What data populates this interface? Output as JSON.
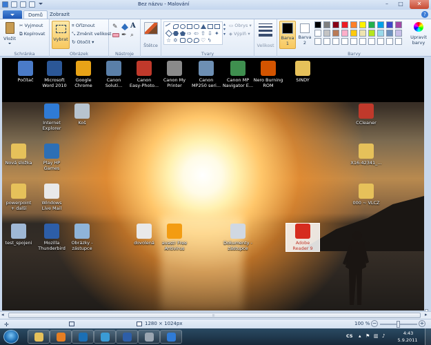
{
  "window": {
    "title": "Bez názvu - Malování"
  },
  "tabs": [
    {
      "label": "Domů",
      "active": true
    },
    {
      "label": "Zobrazit",
      "active": false
    }
  ],
  "ribbon": {
    "clipboard": {
      "paste": "Vložit",
      "cut": "Vyjmout",
      "copy": "Kopírovat",
      "label": "Schránka"
    },
    "image": {
      "select": "Vybrat",
      "crop": "Oříznout",
      "resize": "Změnit velikost",
      "rotate": "Otočit",
      "label": "Obrázek"
    },
    "tools": {
      "label": "Nástroje"
    },
    "brushes": {
      "label": "Štětce"
    },
    "shapes": {
      "outline": "Obrys",
      "fill": "Výplň",
      "label": "Tvary"
    },
    "size": {
      "label": "Velikost"
    },
    "colors": {
      "color1": "Barva\n1",
      "color2": "Barva\n2",
      "edit": "Upravit\nbarvy",
      "label": "Barvy",
      "row1": [
        "#000000",
        "#7f7f7f",
        "#880015",
        "#ed1c24",
        "#ff7f27",
        "#fff200",
        "#22b14c",
        "#00a2e8",
        "#3f48cc",
        "#a349a4"
      ],
      "row2": [
        "#ffffff",
        "#c3c3c3",
        "#b97a57",
        "#ffaec9",
        "#ffc90e",
        "#efe4b0",
        "#b5e61d",
        "#99d9ea",
        "#7092be",
        "#c8bfe7"
      ],
      "primary": "#000000",
      "secondary": "#ffffff"
    }
  },
  "desktop": {
    "top_icons": [
      {
        "label": "Počítač",
        "icon": "computer-icon",
        "color": "#4a7bc8"
      },
      {
        "label": "Microsoft\nWord 2010",
        "icon": "word-icon",
        "color": "#2b5797"
      },
      {
        "label": "Google\nChrome",
        "icon": "chrome-icon",
        "color": "#e8a317"
      },
      {
        "label": "Canon\nSoluti...",
        "icon": "canon-solution-icon",
        "color": "#5a7fa8"
      },
      {
        "label": "Canon\nEasy-Photo...",
        "icon": "canon-easyphoto-icon",
        "color": "#c0392b"
      },
      {
        "label": "Canon My\nPrinter",
        "icon": "canon-printer-icon",
        "color": "#8a8a8a"
      },
      {
        "label": "Canon\nMP250 seri...",
        "icon": "canon-mp250-icon",
        "color": "#6d8fb3"
      },
      {
        "label": "Canon MP\nNavigator E...",
        "icon": "canon-navigator-icon",
        "color": "#3f8f4f"
      },
      {
        "label": "Nero Burning\nROM",
        "icon": "nero-icon",
        "color": "#d35400"
      },
      {
        "label": "SINDY",
        "icon": "folder-icon",
        "color": "#e6c15a"
      }
    ],
    "icons": [
      {
        "label": "Internet\nExplorer",
        "icon": "ie-icon",
        "color": "#2f7bd6",
        "col": "c2",
        "row": "r1"
      },
      {
        "label": "Koš",
        "icon": "recycle-bin-icon",
        "color": "#b8c4cf",
        "col": "c3",
        "row": "r1"
      },
      {
        "label": "CCleaner",
        "icon": "ccleaner-icon",
        "color": "#c0392b",
        "col": "c12",
        "row": "r1"
      },
      {
        "label": "Nová složka",
        "icon": "folder-icon",
        "color": "#e6c15a",
        "col": "c1",
        "row": "r2"
      },
      {
        "label": "Play HP\nGames",
        "icon": "hp-games-icon",
        "color": "#2d6fb5",
        "col": "c2",
        "row": "r2"
      },
      {
        "label": "X16-42341_...",
        "icon": "folder-icon",
        "color": "#e6c15a",
        "col": "c12",
        "row": "r2"
      },
      {
        "label": "powerpoint\n+ další",
        "icon": "folder-icon",
        "color": "#e6c15a",
        "col": "c1",
        "row": "r3"
      },
      {
        "label": "Windows\nLive Mail",
        "icon": "live-mail-icon",
        "color": "#e9e9e9",
        "col": "c2",
        "row": "r3"
      },
      {
        "label": "000 ~ VLCZ",
        "icon": "folder-icon",
        "color": "#e6c15a",
        "col": "c12",
        "row": "r3"
      },
      {
        "label": "test_spojeni",
        "icon": "settings-icon",
        "color": "#9fb8d6",
        "col": "c1",
        "row": "r4"
      },
      {
        "label": "Mozilla\nThunderbird",
        "icon": "thunderbird-icon",
        "color": "#2d5ea8",
        "col": "c2",
        "row": "r4"
      },
      {
        "label": "Obrázky -\nzástupce",
        "icon": "pictures-icon",
        "color": "#8fb4d8",
        "col": "c3",
        "row": "r4"
      },
      {
        "label": "dovolená",
        "icon": "pdf-file-icon",
        "color": "#e9e9e9",
        "col": "c5",
        "row": "r4"
      },
      {
        "label": "avast! Free\nAntivirus",
        "icon": "avast-icon",
        "color": "#f39c12",
        "col": "c6",
        "row": "r4"
      },
      {
        "label": "Dokumenty -\nzástupce",
        "icon": "documents-icon",
        "color": "#d0d8e2",
        "col": "c8",
        "row": "r4"
      },
      {
        "label": "Adobe\nReader 9",
        "icon": "adobe-reader-icon",
        "color": "#d62c1f",
        "col": "c10",
        "row": "r4",
        "selected": true
      }
    ]
  },
  "status": {
    "dimensions": "1280 × 1024px",
    "zoom": "100 %",
    "zoom_level": 0.5
  },
  "taskbar": {
    "buttons": [
      "explorer-icon",
      "media-player-icon",
      "hp-icon",
      "paint-icon",
      "thunderbird-icon",
      "printer-icon",
      "ie-icon"
    ],
    "language": "CS",
    "time": "4:43",
    "date": "5.9.2011"
  }
}
